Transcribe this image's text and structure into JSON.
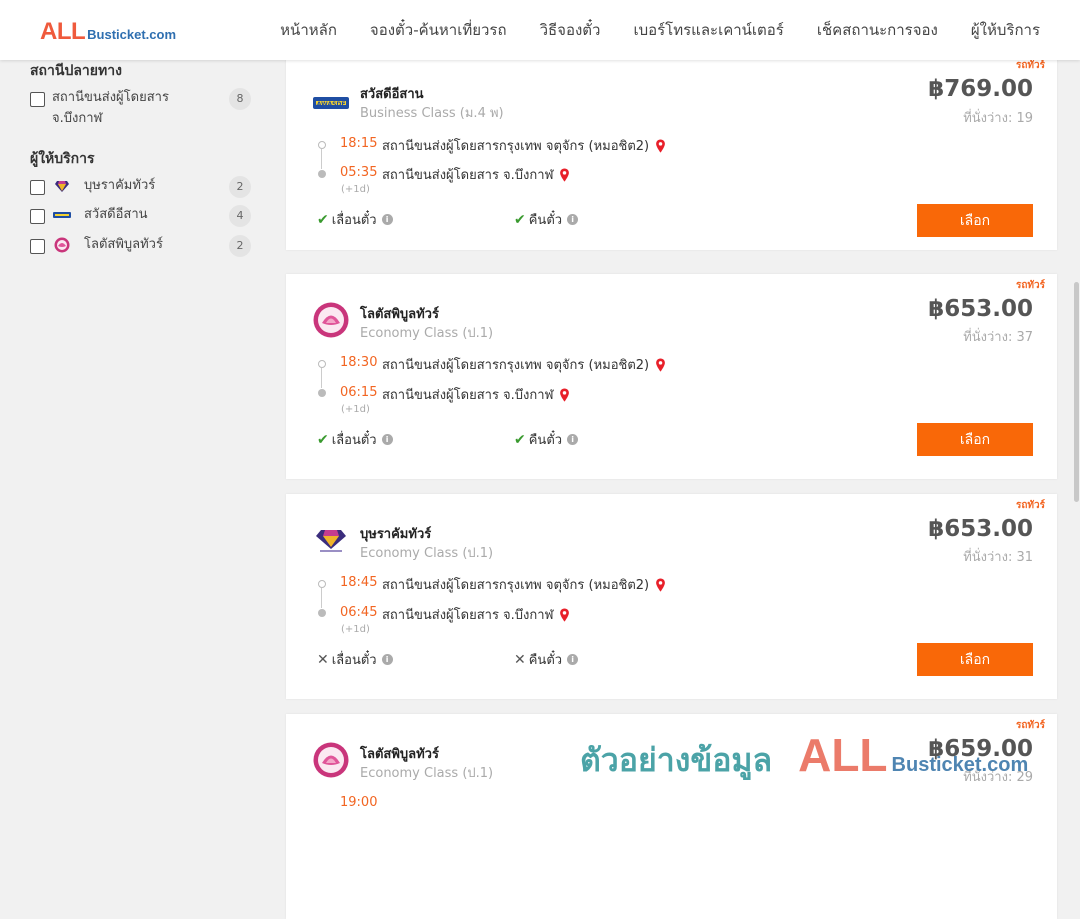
{
  "header": {
    "logo_all": "ALL",
    "logo_rest": "Busticket.com",
    "nav": [
      "หน้าหลัก",
      "จองตั๋ว-ค้นหาเที่ยวรถ",
      "วิธีจองตั๋ว",
      "เบอร์โทรและเคาน์เตอร์",
      "เช็คสถานะการจอง",
      "ผู้ให้บริการ"
    ]
  },
  "sidebar": {
    "destination_title": "สถานีปลายทาง",
    "destination": {
      "label": "สถานีขนส่งผู้โดยสาร จ.บึงกาฬ",
      "count": "8"
    },
    "operators_title": "ผู้ให้บริการ",
    "operators": [
      {
        "label": "บุษราคัมทัวร์",
        "count": "2",
        "icon": "diamond-logo-icon"
      },
      {
        "label": "สวัสดีอีสาน",
        "count": "4",
        "icon": "sawasdee-logo-icon"
      },
      {
        "label": "โลตัสพิบูลทัวร์",
        "count": "2",
        "icon": "lotus-logo-icon"
      }
    ]
  },
  "trips": [
    {
      "bus_type": "รถทัวร์",
      "operator": "สวัสดีอีสาน",
      "class": "Business Class (ม.4 พ)",
      "price": "฿769.00",
      "seats": "ที่นั่งว่าง: 19",
      "depart_time": "18:15",
      "depart_station": "สถานีขนส่งผู้โดยสารกรุงเทพ จตุจักร (หมอชิต2)",
      "arrive_time": "05:35",
      "arrive_station": "สถานีขนส่งผู้โดยสาร จ.บึงกาฬ",
      "plus_day": "(+1d)",
      "postpone": "เลื่อนตั๋ว",
      "refund": "คืนตั๋ว",
      "postpone_ok": true,
      "refund_ok": true,
      "button": "เลือก",
      "logo": "sawasdee-logo-icon"
    },
    {
      "bus_type": "รถทัวร์",
      "operator": "โลตัสพิบูลทัวร์",
      "class": "Economy Class (ป.1)",
      "price": "฿653.00",
      "seats": "ที่นั่งว่าง: 37",
      "depart_time": "18:30",
      "depart_station": "สถานีขนส่งผู้โดยสารกรุงเทพ จตุจักร (หมอชิต2)",
      "arrive_time": "06:15",
      "arrive_station": "สถานีขนส่งผู้โดยสาร จ.บึงกาฬ",
      "plus_day": "(+1d)",
      "postpone": "เลื่อนตั๋ว",
      "refund": "คืนตั๋ว",
      "postpone_ok": true,
      "refund_ok": true,
      "button": "เลือก",
      "logo": "lotus-logo-icon"
    },
    {
      "bus_type": "รถทัวร์",
      "operator": "บุษราคัมทัวร์",
      "class": "Economy Class (ป.1)",
      "price": "฿653.00",
      "seats": "ที่นั่งว่าง: 31",
      "depart_time": "18:45",
      "depart_station": "สถานีขนส่งผู้โดยสารกรุงเทพ จตุจักร (หมอชิต2)",
      "arrive_time": "06:45",
      "arrive_station": "สถานีขนส่งผู้โดยสาร จ.บึงกาฬ",
      "plus_day": "(+1d)",
      "postpone": "เลื่อนตั๋ว",
      "refund": "คืนตั๋ว",
      "postpone_ok": false,
      "refund_ok": false,
      "button": "เลือก",
      "logo": "diamond-logo-icon"
    },
    {
      "bus_type": "รถทัวร์",
      "operator": "โลตัสพิบูลทัวร์",
      "class": "Economy Class (ป.1)",
      "price": "฿659.00",
      "seats": "ที่นั่งว่าง: 29",
      "depart_time": "19:00",
      "logo": "lotus-logo-icon"
    }
  ],
  "watermark": {
    "text": "ตัวอย่างข้อมูล",
    "all": "ALL",
    "rest": "Busticket.com"
  },
  "colors": {
    "accent": "#f96808",
    "time": "#f26522",
    "pin": "#e8202a",
    "check": "#3a9a2f"
  }
}
